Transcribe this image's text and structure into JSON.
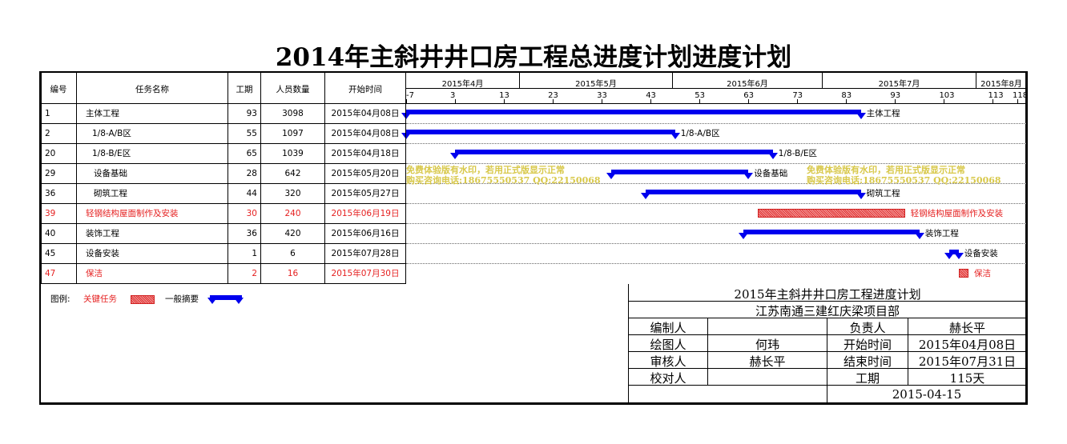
{
  "title": "2014年主斜井井口房工程总进度计划进度计划",
  "table": {
    "headers": {
      "id": "编号",
      "name": "任务名称",
      "duration": "工期",
      "people": "人员数量",
      "start": "开始时间"
    },
    "rows": [
      {
        "id": "1",
        "name": "主体工程",
        "duration": "93",
        "people": "3098",
        "start": "2015年04月08日",
        "critical": false
      },
      {
        "id": "2",
        "name": "1/8-A/B区",
        "duration": "55",
        "people": "1097",
        "start": "2015年04月08日",
        "critical": false
      },
      {
        "id": "20",
        "name": "1/8-B/E区",
        "duration": "65",
        "people": "1039",
        "start": "2015年04月18日",
        "critical": false
      },
      {
        "id": "29",
        "name": "设备基础",
        "duration": "28",
        "people": "642",
        "start": "2015年05月20日",
        "critical": false
      },
      {
        "id": "36",
        "name": "砌筑工程",
        "duration": "44",
        "people": "320",
        "start": "2015年05月27日",
        "critical": false
      },
      {
        "id": "39",
        "name": "轻钢结构屋面制作及安装",
        "duration": "30",
        "people": "240",
        "start": "2015年06月19日",
        "critical": true
      },
      {
        "id": "40",
        "name": "装饰工程",
        "duration": "36",
        "people": "420",
        "start": "2015年06月16日",
        "critical": false
      },
      {
        "id": "45",
        "name": "设备安装",
        "duration": "1",
        "people": "6",
        "start": "2015年07月28日",
        "critical": false
      },
      {
        "id": "47",
        "name": "保洁",
        "duration": "2",
        "people": "16",
        "start": "2015年07月30日",
        "critical": true
      }
    ]
  },
  "timeline": {
    "months": [
      "2015年4月",
      "2015年5月",
      "2015年6月",
      "2015年7月",
      "2015年8月"
    ],
    "ticks": [
      "-7",
      "3",
      "13",
      "23",
      "33",
      "43",
      "53",
      "63",
      "73",
      "83",
      "93",
      "103",
      "113",
      "118"
    ]
  },
  "bars": [
    {
      "label": "主体工程",
      "start": -7,
      "end": 86,
      "type": "summary"
    },
    {
      "label": "1/8-A/B区",
      "start": -7,
      "end": 48,
      "type": "summary"
    },
    {
      "label": "1/8-B/E区",
      "start": 3,
      "end": 68,
      "type": "summary"
    },
    {
      "label": "设备基础",
      "start": 35,
      "end": 63,
      "type": "summary"
    },
    {
      "label": "砌筑工程",
      "start": 42,
      "end": 86,
      "type": "summary"
    },
    {
      "label": "轻钢结构屋面制作及安装",
      "start": 65,
      "end": 95,
      "type": "critical"
    },
    {
      "label": "装饰工程",
      "start": 62,
      "end": 98,
      "type": "summary"
    },
    {
      "label": "设备安装",
      "start": 104,
      "end": 106,
      "type": "summary"
    },
    {
      "label": "保洁",
      "start": 106,
      "end": 108,
      "type": "critical"
    }
  ],
  "watermark": {
    "line1": "免费体验版有水印，若用正式版显示正常",
    "line2": "购买咨询电话:18675550537 QQ:22150068"
  },
  "legend": {
    "label": "图例:",
    "critical": "关键任务",
    "summary": "一般摘要"
  },
  "titleblock": {
    "plan_title": "2015年主斜井井口房工程进度计划",
    "dept": "江苏南通三建红庆梁项目部",
    "compiler_label": "编制人",
    "compiler": "",
    "owner_label": "负责人",
    "owner": "赫长平",
    "drafter_label": "绘图人",
    "drafter": "何玮",
    "start_label": "开始时间",
    "start": "2015年04月08日",
    "reviewer_label": "审核人",
    "reviewer": "赫长平",
    "end_label": "结束时间",
    "end": "2015年07月31日",
    "checker_label": "校对人",
    "checker": "",
    "duration_label": "工期",
    "duration": "115天",
    "date": "2015-04-15"
  },
  "colors": {
    "summary_bar": "#0000ee",
    "critical_text": "#e52020",
    "critical_fill": "#e03030"
  }
}
